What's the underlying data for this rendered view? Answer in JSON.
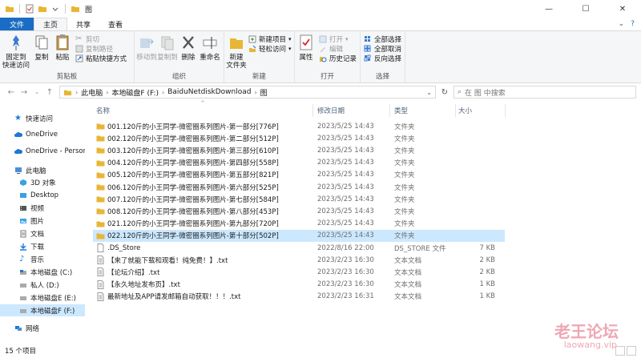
{
  "window": {
    "title": "图"
  },
  "tabs": [
    {
      "label": "文件"
    },
    {
      "label": "主页"
    },
    {
      "label": "共享"
    },
    {
      "label": "查看"
    }
  ],
  "ribbon": {
    "clipboard": {
      "label": "剪贴板",
      "pin": "固定到\n快速访问",
      "copy": "复制",
      "paste": "粘贴",
      "cut": "剪切",
      "copy_path": "复制路径",
      "paste_shortcut": "粘贴快捷方式"
    },
    "organize": {
      "label": "组织",
      "move_to": "移动到",
      "copy_to": "复制到",
      "delete": "删除",
      "rename": "重命名"
    },
    "new": {
      "label": "新建",
      "new_folder": "新建\n文件夹",
      "new_item": "新建项目",
      "easy_access": "轻松访问"
    },
    "open": {
      "label": "打开",
      "properties": "属性",
      "open": "打开",
      "edit": "编辑",
      "history": "历史记录"
    },
    "select": {
      "label": "选择",
      "select_all": "全部选择",
      "select_none": "全部取消",
      "invert": "反向选择"
    }
  },
  "address": {
    "crumbs": [
      "此电脑",
      "本地磁盘F (F:)",
      "BaiduNetdiskDownload",
      "图"
    ],
    "search_placeholder": "在 图 中搜索"
  },
  "nav": {
    "items": [
      {
        "label": "快速访问",
        "icon": "star-icon",
        "color": "#1e78d7"
      },
      {
        "label": "OneDrive",
        "icon": "cloud-icon",
        "color": "#1e78d7"
      },
      {
        "label": "OneDrive - Persona",
        "icon": "cloud-icon",
        "color": "#1e78d7"
      },
      {
        "label": "此电脑",
        "icon": "computer-icon",
        "color": "#4a90d9"
      },
      {
        "label": "3D 对象",
        "icon": "cube-icon",
        "color": "#3aa0e6"
      },
      {
        "label": "Desktop",
        "icon": "desktop-icon",
        "color": "#3aa0e6"
      },
      {
        "label": "视频",
        "icon": "video-icon",
        "color": "#555555"
      },
      {
        "label": "图片",
        "icon": "picture-icon",
        "color": "#3aa0e6"
      },
      {
        "label": "文档",
        "icon": "document-icon",
        "color": "#777777"
      },
      {
        "label": "下载",
        "icon": "download-icon",
        "color": "#1e78d7"
      },
      {
        "label": "音乐",
        "icon": "music-icon",
        "color": "#1e78d7"
      },
      {
        "label": "本地磁盘 (C:)",
        "icon": "drive-icon",
        "color": "#888888"
      },
      {
        "label": "私人 (D:)",
        "icon": "drive-icon",
        "color": "#888888"
      },
      {
        "label": "本地磁盘E (E:)",
        "icon": "drive-icon",
        "color": "#888888"
      },
      {
        "label": "本地磁盘F (F:)",
        "icon": "drive-icon",
        "color": "#888888"
      },
      {
        "label": "网络",
        "icon": "network-icon",
        "color": "#1e78d7"
      }
    ]
  },
  "columns": {
    "name": "名称",
    "date": "修改日期",
    "type": "类型",
    "size": "大小"
  },
  "files": [
    {
      "name": "001.120斤的小王同学-微密圈系列图片-第一部分[776P]",
      "date": "2023/5/25 14:43",
      "type": "文件夹",
      "size": "",
      "kind": "folder"
    },
    {
      "name": "002.120斤的小王同学-微密圈系列图片-第二部分[512P]",
      "date": "2023/5/25 14:43",
      "type": "文件夹",
      "size": "",
      "kind": "folder"
    },
    {
      "name": "003.120斤的小王同学-微密圈系列图片-第三部分[610P]",
      "date": "2023/5/25 14:43",
      "type": "文件夹",
      "size": "",
      "kind": "folder"
    },
    {
      "name": "004.120斤的小王同学-微密圈系列图片-第四部分[558P]",
      "date": "2023/5/25 14:43",
      "type": "文件夹",
      "size": "",
      "kind": "folder"
    },
    {
      "name": "005.120斤的小王同学-微密圈系列图片-第五部分[821P]",
      "date": "2023/5/25 14:43",
      "type": "文件夹",
      "size": "",
      "kind": "folder"
    },
    {
      "name": "006.120斤的小王同学-微密圈系列图片-第六部分[525P]",
      "date": "2023/5/25 14:43",
      "type": "文件夹",
      "size": "",
      "kind": "folder"
    },
    {
      "name": "007.120斤的小王同学-微密圈系列图片-第七部分[584P]",
      "date": "2023/5/25 14:43",
      "type": "文件夹",
      "size": "",
      "kind": "folder"
    },
    {
      "name": "008.120斤的小王同学-微密圈系列图片-第八部分[453P]",
      "date": "2023/5/25 14:43",
      "type": "文件夹",
      "size": "",
      "kind": "folder"
    },
    {
      "name": "021.120斤的小王同学-微密圈系列图片-第九部分[720P]",
      "date": "2023/5/25 14:43",
      "type": "文件夹",
      "size": "",
      "kind": "folder"
    },
    {
      "name": "022.120斤的小王同学-微密圈系列图片-第十部分[502P]",
      "date": "2023/5/25 14:43",
      "type": "文件夹",
      "size": "",
      "kind": "folder"
    },
    {
      "name": ".DS_Store",
      "date": "2022/8/16 22:00",
      "type": "DS_STORE 文件",
      "size": "7 KB",
      "kind": "file"
    },
    {
      "name": "【来了就能下载和观看！纯免费！】.txt",
      "date": "2023/2/23 16:30",
      "type": "文本文档",
      "size": "2 KB",
      "kind": "text"
    },
    {
      "name": "【论坛介绍】.txt",
      "date": "2023/2/23 16:30",
      "type": "文本文档",
      "size": "2 KB",
      "kind": "text"
    },
    {
      "name": "【永久地址发布页】.txt",
      "date": "2023/2/23 16:30",
      "type": "文本文档",
      "size": "1 KB",
      "kind": "text"
    },
    {
      "name": "最新地址及APP请发邮箱自动获取！！！.txt",
      "date": "2023/2/23 16:31",
      "type": "文本文档",
      "size": "1 KB",
      "kind": "text"
    }
  ],
  "status": {
    "count": "15 个项目"
  },
  "watermark": {
    "line1": "老王论坛",
    "line2": "laowang.vip"
  },
  "colors": {
    "accent": "#1a6cc4",
    "selection": "#cce8ff",
    "folder": "#e8b636"
  }
}
